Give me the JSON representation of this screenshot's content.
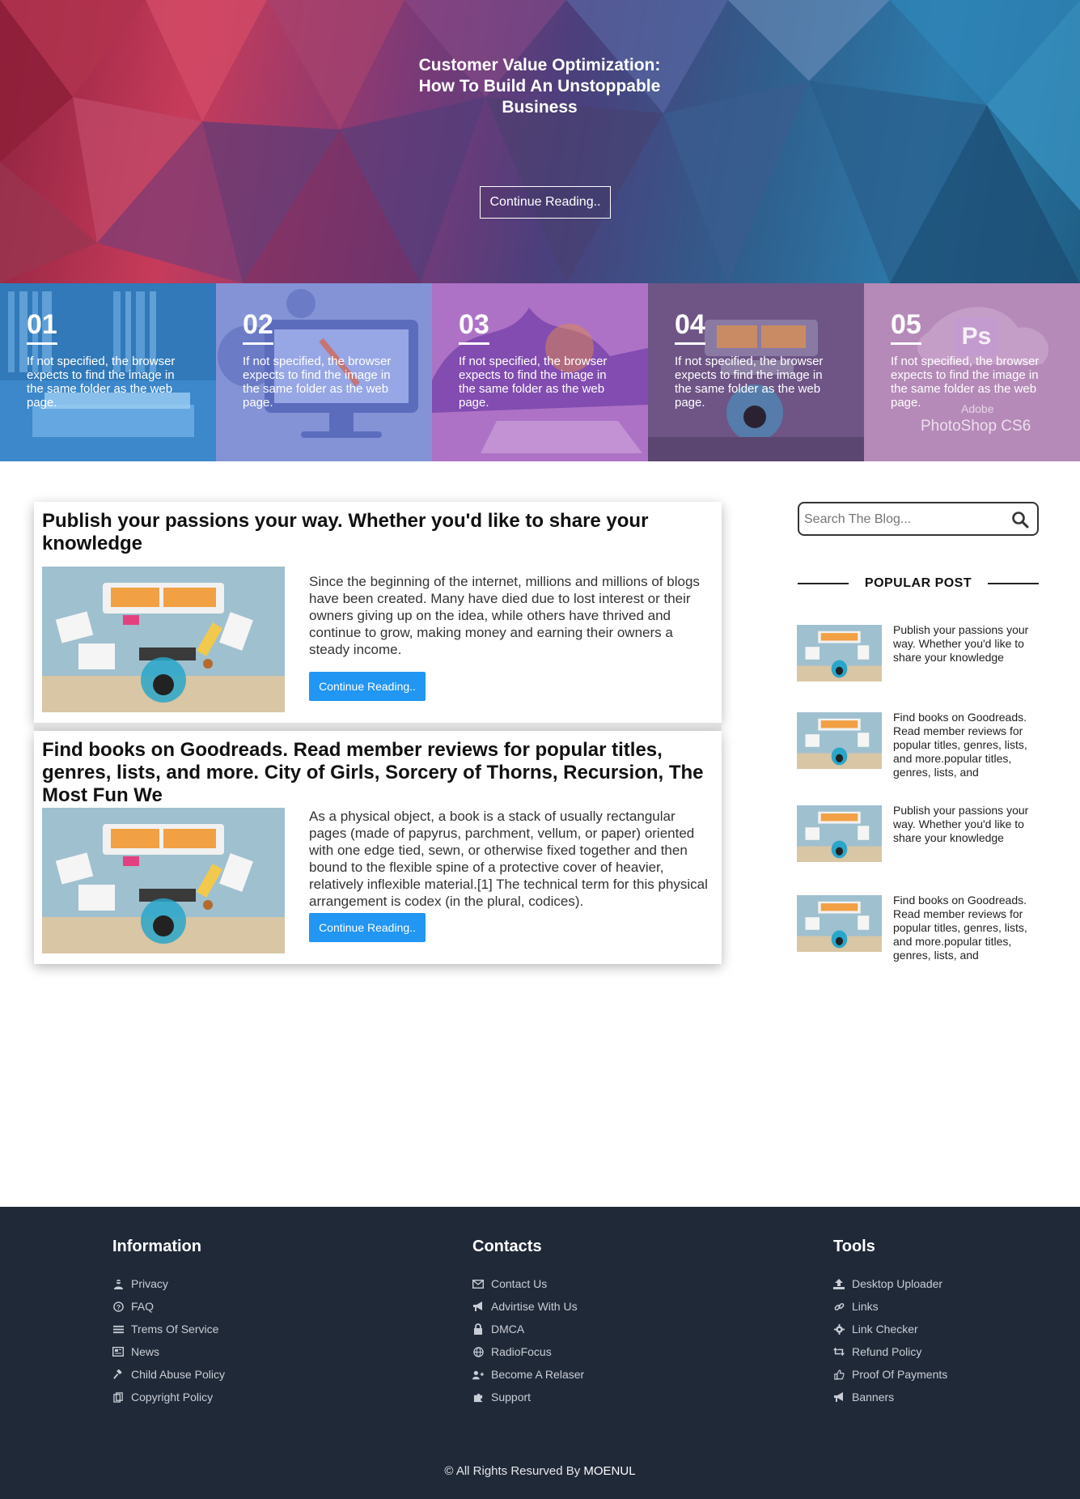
{
  "hero": {
    "title": "Customer Value Optimization: How To Build An Unstoppable Business",
    "button": "Continue Reading.."
  },
  "tiles": [
    {
      "num": "01",
      "text": "If not specified, the browser expects to find the image in the same folder as the web page."
    },
    {
      "num": "02",
      "text": "If not specified, the browser expects to find the image in the same folder as the web page."
    },
    {
      "num": "03",
      "text": "If not specified, the browser expects to find the image in the same folder as the web page."
    },
    {
      "num": "04",
      "text": "If not specified, the browser expects to find the image in the same folder as the web page."
    },
    {
      "num": "05",
      "text": "If not specified, the browser expects to find the image in the same folder as the web page.",
      "overlay_brand": "Adobe",
      "overlay_product": "PhotoShop CS6",
      "overlay_logo": "Ps"
    }
  ],
  "posts": [
    {
      "title": "Publish your passions your way. Whether you'd like to share your knowledge",
      "body": "Since the beginning of the internet, millions and millions of blogs have been created. Many have died due to lost interest or their owners giving up on the idea, while others have thrived and continue to grow, making money and earning their owners a steady income.",
      "button": "Continue Reading.."
    },
    {
      "title": "Find books on Goodreads. Read member reviews for popular titles, genres, lists, and more. City of Girls, Sorcery of Thorns, Recursion, The Most Fun We",
      "body": "As a physical object, a book is a stack of usually rectangular pages (made of papyrus, parchment, vellum, or paper) oriented with one edge tied, sewn, or otherwise fixed together and then bound to the flexible spine of a protective cover of heavier, relatively inflexible material.[1] The technical term for this physical arrangement is codex (in the plural, codices).",
      "button": "Continue Reading.."
    }
  ],
  "sidebar": {
    "search_placeholder": "Search The Blog...",
    "popular_heading": "POPULAR POST",
    "popular": [
      "Publish your passions your way. Whether you'd like to share your knowledge",
      "Find books on Goodreads. Read member reviews for popular titles, genres, lists, and more.popular titles, genres, lists, and",
      "Publish your passions your way. Whether you'd like to share your knowledge",
      "Find books on Goodreads. Read member reviews for popular titles, genres, lists, and more.popular titles, genres, lists, and"
    ]
  },
  "footer": {
    "columns": [
      {
        "heading": "Information",
        "links": [
          {
            "label": "Privacy",
            "icon": "user-secret-icon"
          },
          {
            "label": "FAQ",
            "icon": "question-circle-icon"
          },
          {
            "label": "Trems Of Service",
            "icon": "bars-icon"
          },
          {
            "label": "News",
            "icon": "newspaper-icon"
          },
          {
            "label": "Child Abuse Policy",
            "icon": "gavel-icon"
          },
          {
            "label": "Copyright Policy",
            "icon": "copy-icon"
          }
        ]
      },
      {
        "heading": "Contacts",
        "links": [
          {
            "label": "Contact Us",
            "icon": "envelope-icon"
          },
          {
            "label": "Advirtise With Us",
            "icon": "bullhorn-icon"
          },
          {
            "label": "DMCA",
            "icon": "lock-icon"
          },
          {
            "label": "RadioFocus",
            "icon": "globe-icon"
          },
          {
            "label": "Become A Relaser",
            "icon": "user-plus-icon"
          },
          {
            "label": "Support",
            "icon": "puzzle-icon"
          }
        ]
      },
      {
        "heading": "Tools",
        "links": [
          {
            "label": "Desktop Uploader",
            "icon": "upload-icon"
          },
          {
            "label": "Links",
            "icon": "link-icon"
          },
          {
            "label": "Link Checker",
            "icon": "gear-icon"
          },
          {
            "label": "Refund Policy",
            "icon": "retweet-icon"
          },
          {
            "label": "Proof Of Payments",
            "icon": "thumbs-up-icon"
          },
          {
            "label": "Banners",
            "icon": "bullhorn-icon"
          }
        ]
      }
    ],
    "copyright_prefix": "© All Rights Resurved By",
    "copyright_name": "MOENUL"
  },
  "colors": {
    "accent": "#2196f3",
    "footer_bg": "#202938"
  }
}
